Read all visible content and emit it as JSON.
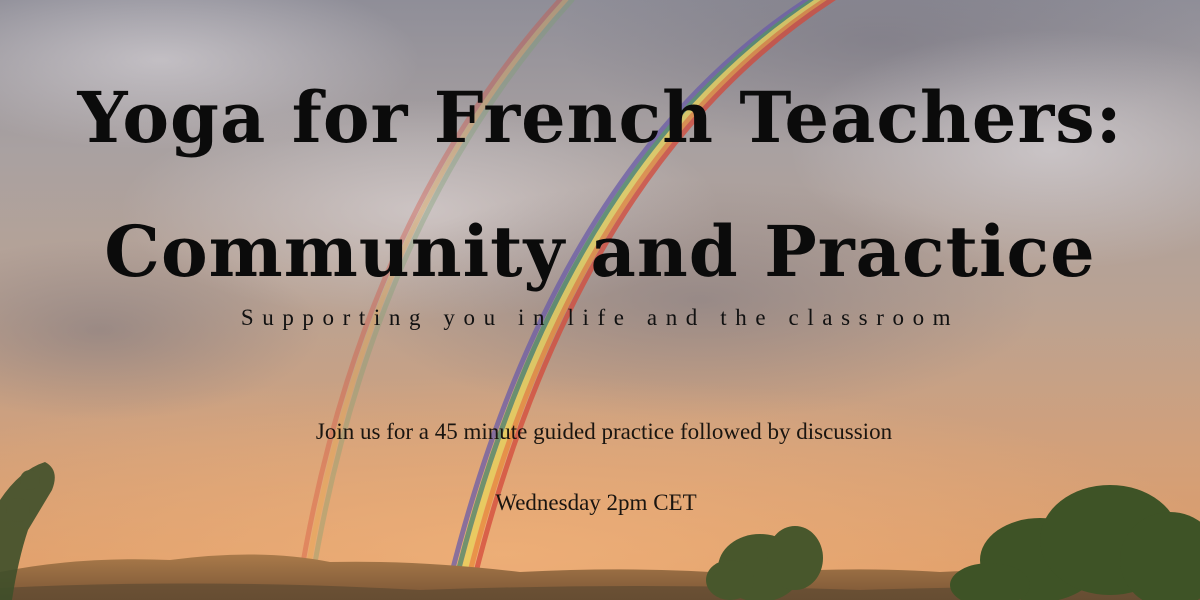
{
  "title_line1": "Yoga for French Teachers:",
  "title_line2": "Community and Practice",
  "subtitle": "Supporting you in life and the classroom",
  "invitation": "Join us for a 45 minute guided practice followed by discussion",
  "schedule": "Wednesday 2pm CET",
  "colors": {
    "sky_top": "#9d9aa0",
    "sky_mid": "#b7a396",
    "sky_low": "#d69a6e",
    "text": "#0b0b0b"
  }
}
